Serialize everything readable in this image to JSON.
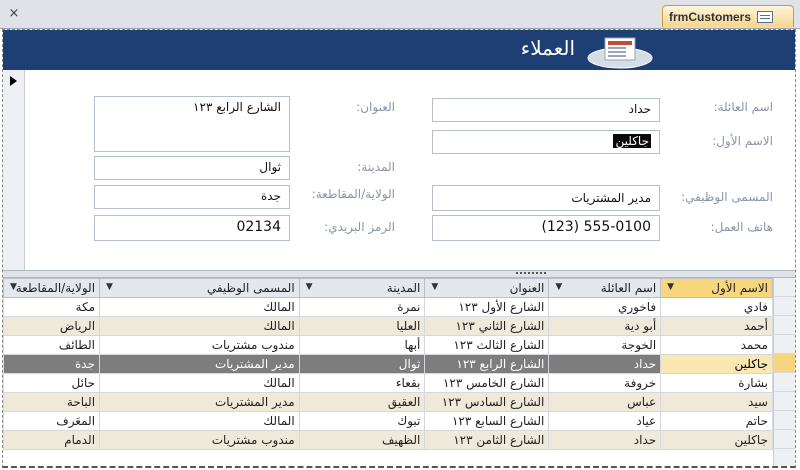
{
  "tab": {
    "close": "×",
    "label": "frmCustomers"
  },
  "header": {
    "title": "العملاء"
  },
  "fields": {
    "last_name": {
      "label": "اسم العائلة:",
      "value": "حداد"
    },
    "first_name": {
      "label": "الاسم الأول:",
      "value": "جاكلين"
    },
    "job_title": {
      "label": "المسمى الوظيفي:",
      "value": "مدير المشتريات"
    },
    "work_phone": {
      "label": "هاتف العمل:",
      "value": "(123) 555-0100"
    },
    "address": {
      "label": "العنوان:",
      "value": "الشارع الرابع ١٢٣"
    },
    "city": {
      "label": "المدينة:",
      "value": "ثوال"
    },
    "state": {
      "label": "الولاية/المقاطعة:",
      "value": "جدة"
    },
    "zip": {
      "label": "الرمز البريدي:",
      "value": "02134"
    }
  },
  "grid": {
    "headers": [
      "الاسم الأول",
      "اسم العائلة",
      "العنوان",
      "المدينة",
      "المسمى الوظيفي",
      "الولاية/المقاطعة"
    ],
    "rows": [
      [
        "فادي",
        "فاخوري",
        "الشارع الأول ١٢٣",
        "نمرة",
        "المالك",
        "مكة"
      ],
      [
        "أحمد",
        "أبو دية",
        "الشارع الثاني ١٢٣",
        "العليا",
        "المالك",
        "الرياض"
      ],
      [
        "محمد",
        "الخوجة",
        "الشارع الثالث ١٢٣",
        "أبها",
        "مندوب مشتريات",
        "الطائف"
      ],
      [
        "جاكلين",
        "حداد",
        "الشارع الرابع ١٢٣",
        "ثوال",
        "مدير المشتريات",
        "جدة"
      ],
      [
        "بشارة",
        "خروفة",
        "الشارع الخامس ١٢٣",
        "بقعاء",
        "المالك",
        "حائل"
      ],
      [
        "سيد",
        "عباس",
        "الشارع السادس ١٢٣",
        "العقيق",
        "مدير المشتريات",
        "الباحة"
      ],
      [
        "حاتم",
        "عياد",
        "الشارع السابع ١٢٣",
        "تبوك",
        "المالك",
        "المعَرف"
      ],
      [
        "جاكلين",
        "حداد",
        "الشارع الثامن ١٢٣",
        "الظهيف",
        "مندوب مشتريات",
        "الدمام"
      ]
    ]
  }
}
